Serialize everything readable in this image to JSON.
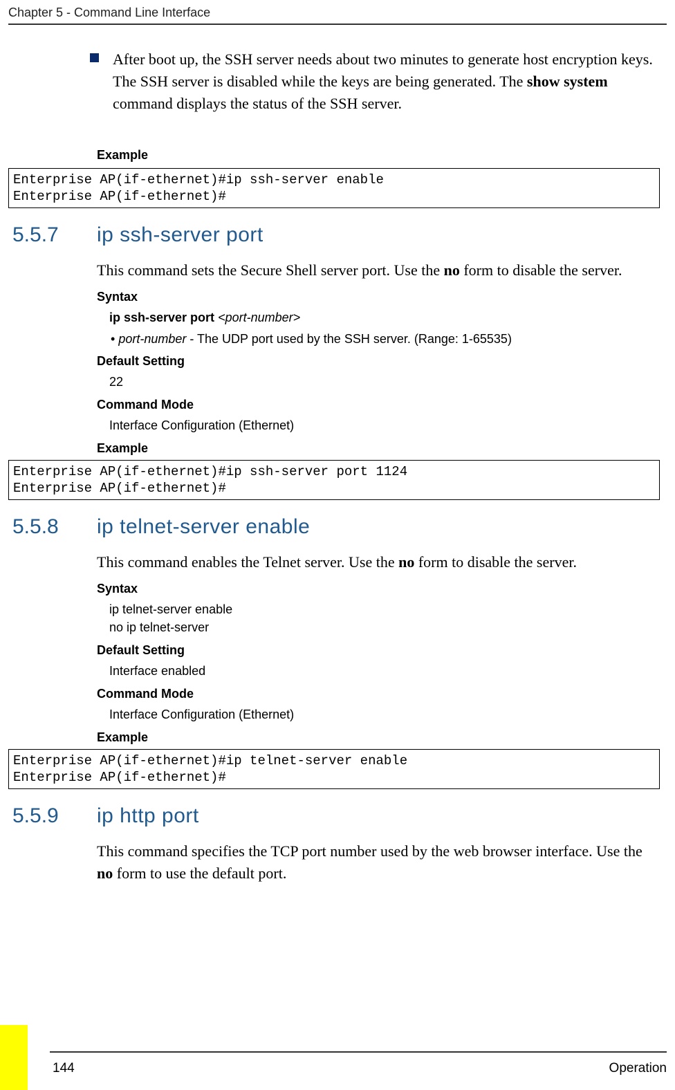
{
  "header": "Chapter 5 - Command Line Interface",
  "bullet1_pre": "After boot up, the SSH server needs about two minutes to generate host encryption keys. The SSH server is disabled while the keys are being generated. The ",
  "bullet1_cmd": "show system",
  "bullet1_post": " command displays the status of the SSH server.",
  "labels": {
    "example": "Example",
    "syntax": "Syntax",
    "default": "Default Setting",
    "mode": "Command Mode"
  },
  "example1": "Enterprise AP(if-ethernet)#ip ssh-server enable\nEnterprise AP(if-ethernet)#",
  "s557": {
    "num": "5.5.7",
    "title": "ip ssh-server port",
    "body_pre": "This command sets the Secure Shell server port. Use the ",
    "body_no": "no",
    "body_post": " form to disable the server.",
    "syntax_bold": "ip ssh-server port ",
    "syntax_italic": "<port-number>",
    "param_bullet_pre": "•  ",
    "param_name": "port-number",
    "param_desc": " - The UDP port used by the SSH server. (Range: 1-65535)",
    "default_val": "22",
    "mode_val": "Interface Configuration (Ethernet)",
    "example": "Enterprise AP(if-ethernet)#ip ssh-server port 1124\nEnterprise AP(if-ethernet)#"
  },
  "s558": {
    "num": "5.5.8",
    "title": "ip telnet-server enable",
    "body_pre": "This command enables the Telnet server. Use the ",
    "body_no": "no",
    "body_post": " form to disable the server.",
    "syntax_line1": "ip telnet-server enable",
    "syntax_line2": "no ip telnet-server",
    "default_val": "Interface enabled",
    "mode_val": "Interface Configuration (Ethernet)",
    "example": "Enterprise AP(if-ethernet)#ip telnet-server enable\nEnterprise AP(if-ethernet)#"
  },
  "s559": {
    "num": "5.5.9",
    "title": "ip http port",
    "body_pre": "This command specifies the TCP port number used by the web browser interface. Use the ",
    "body_no": "no",
    "body_post": " form to use the default port."
  },
  "footer": {
    "page": "144",
    "right": "Operation"
  }
}
